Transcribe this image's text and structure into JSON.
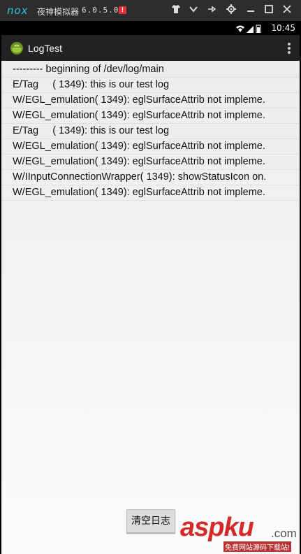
{
  "emulator": {
    "logo": "nox",
    "title": "夜神模拟器",
    "version": "6.0.5.0",
    "badge": "!"
  },
  "statusbar": {
    "time": "10:45"
  },
  "actionbar": {
    "title": "LogTest"
  },
  "log_lines": [
    "--------- beginning of /dev/log/main",
    "E/Tag     ( 1349): this is our test log",
    "W/EGL_emulation( 1349): eglSurfaceAttrib not impleme.",
    "W/EGL_emulation( 1349): eglSurfaceAttrib not impleme.",
    "E/Tag     ( 1349): this is our test log",
    "W/EGL_emulation( 1349): eglSurfaceAttrib not impleme.",
    "W/EGL_emulation( 1349): eglSurfaceAttrib not impleme.",
    "W/IInputConnectionWrapper( 1349): showStatusIcon on.",
    "W/EGL_emulation( 1349): eglSurfaceAttrib not impleme."
  ],
  "clear_button": {
    "label": "清空日志"
  },
  "watermark": {
    "main": "aspku",
    "suffix": ".com",
    "sub": "免费网站源码下载站!"
  }
}
